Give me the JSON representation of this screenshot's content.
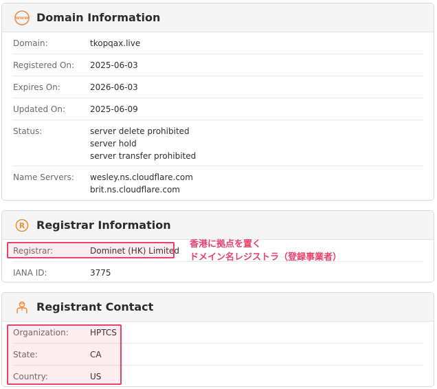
{
  "domain_info": {
    "title": "Domain Information",
    "icon": "www-icon",
    "rows": [
      {
        "label": "Domain:",
        "values": [
          "tkopqax.live"
        ]
      },
      {
        "label": "Registered On:",
        "values": [
          "2025-06-03"
        ]
      },
      {
        "label": "Expires On:",
        "values": [
          "2026-06-03"
        ]
      },
      {
        "label": "Updated On:",
        "values": [
          "2025-06-09"
        ]
      },
      {
        "label": "Status:",
        "values": [
          "server delete prohibited",
          "server hold",
          "server transfer prohibited"
        ]
      },
      {
        "label": "Name Servers:",
        "values": [
          "wesley.ns.cloudflare.com",
          "brit.ns.cloudflare.com"
        ]
      }
    ]
  },
  "registrar_info": {
    "title": "Registrar Information",
    "icon": "registered-icon",
    "rows": [
      {
        "label": "Registrar:",
        "values": [
          "Dominet (HK) Limited"
        ]
      },
      {
        "label": "IANA ID:",
        "values": [
          "3775"
        ]
      }
    ]
  },
  "registrant_contact": {
    "title": "Registrant Contact",
    "icon": "person-icon",
    "rows": [
      {
        "label": "Organization:",
        "values": [
          "HPTCS"
        ]
      },
      {
        "label": "State:",
        "values": [
          "CA"
        ]
      },
      {
        "label": "Country:",
        "values": [
          "US"
        ]
      }
    ]
  },
  "annotation": {
    "lines": [
      "香港に拠点を置く",
      "ドメイン名レジストラ（登録事業者）"
    ]
  },
  "colors": {
    "accent": "#f08a3c",
    "highlight": "#e8416e"
  }
}
